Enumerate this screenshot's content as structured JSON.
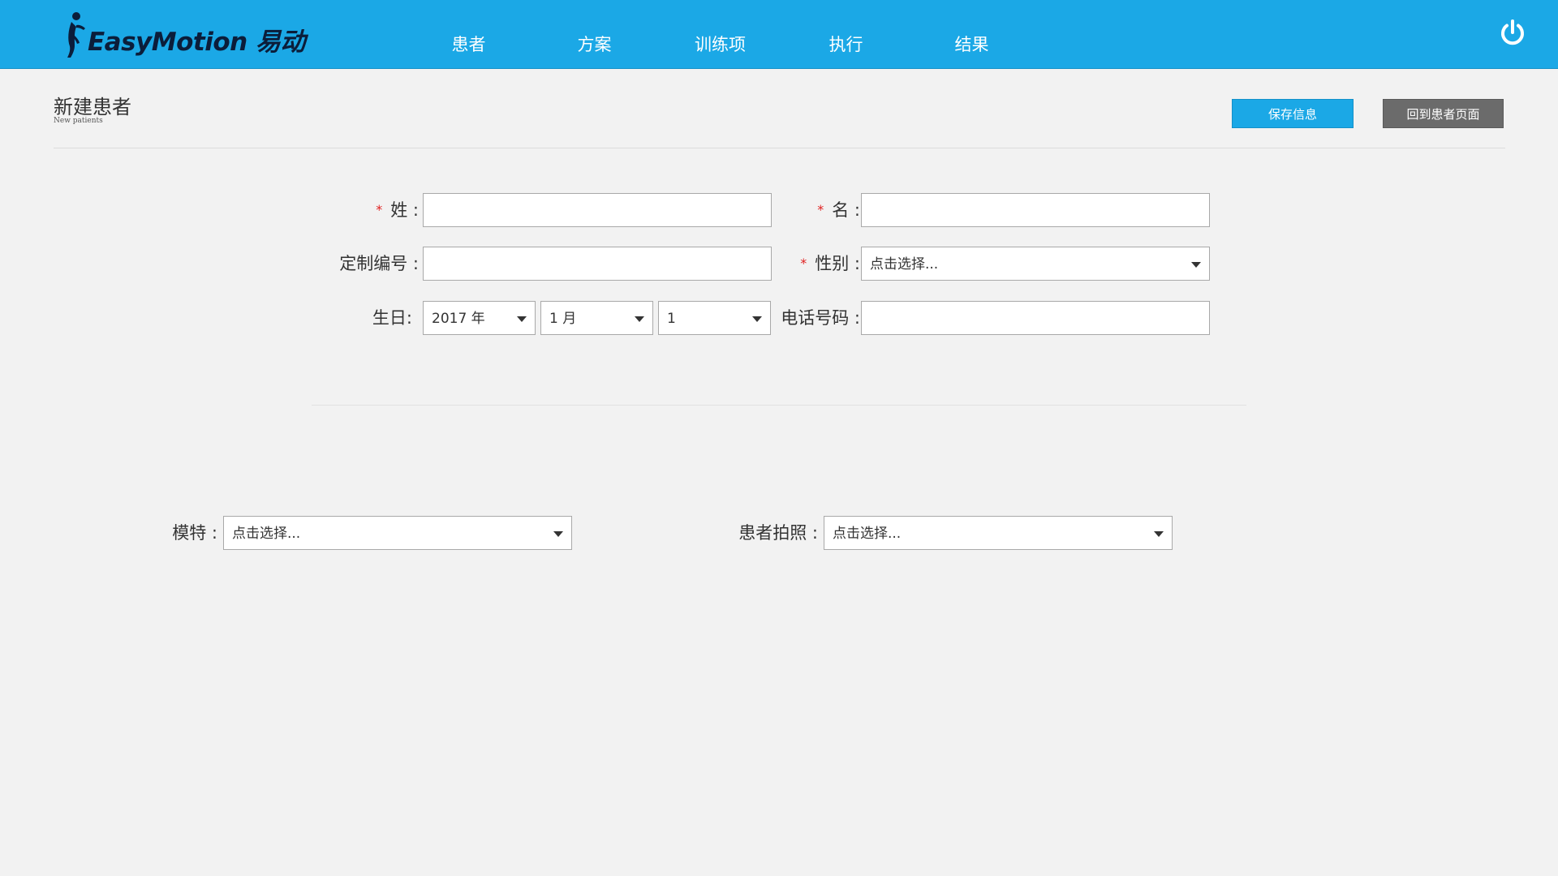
{
  "app": {
    "logo_text": "EasyMotion 易动"
  },
  "nav": {
    "items": [
      {
        "label": "患者"
      },
      {
        "label": "方案"
      },
      {
        "label": "训练项"
      },
      {
        "label": "执行"
      },
      {
        "label": "结果"
      }
    ]
  },
  "header_icons": {
    "power": "power-icon"
  },
  "page": {
    "title": "新建患者",
    "subtitle": "New patients"
  },
  "actions": {
    "save_label": "保存信息",
    "back_label": "回到患者页面"
  },
  "form": {
    "required_mark": "*",
    "surname": {
      "label": "姓 :",
      "value": ""
    },
    "given_name": {
      "label": "名 :",
      "value": ""
    },
    "custom_id": {
      "label": "定制编号 :",
      "value": ""
    },
    "gender": {
      "label": "性别 :",
      "selected": "点击选择..."
    },
    "birthday": {
      "label": "生日:",
      "year": "2017 年",
      "month": "1 月",
      "day": "1"
    },
    "phone": {
      "label": "电话号码 :",
      "value": ""
    },
    "model": {
      "label": "模特 :",
      "selected": "点击选择..."
    },
    "photo": {
      "label": "患者拍照 :",
      "selected": "点击选择..."
    }
  },
  "colors": {
    "primary": "#1ba8e6",
    "secondary_button": "#6b6b6b",
    "background": "#f2f2f2",
    "required": "#e02020"
  }
}
